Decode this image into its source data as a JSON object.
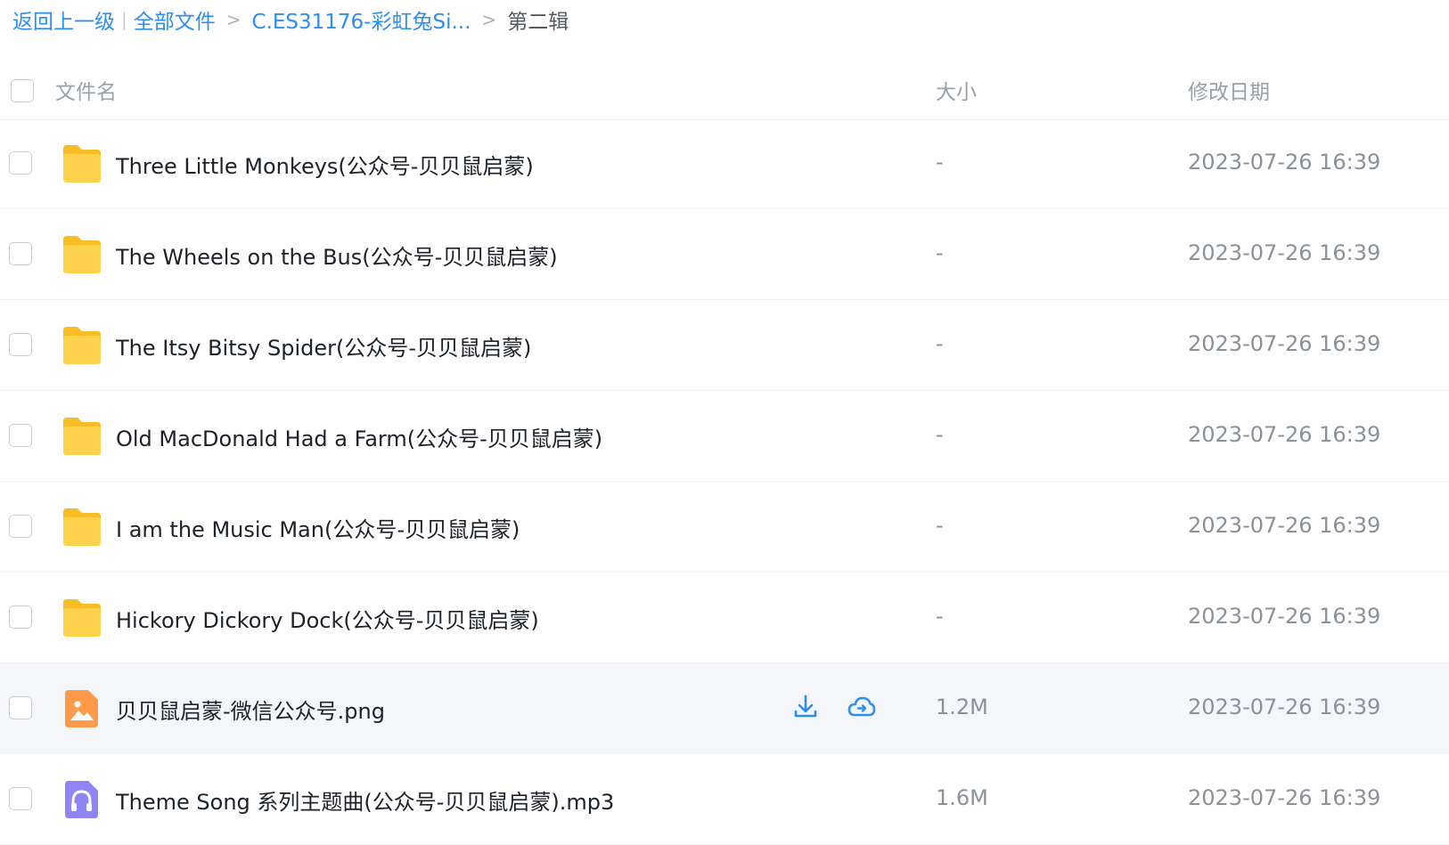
{
  "breadcrumb": {
    "back": "返回上一级",
    "separator": "|",
    "all_files": "全部文件",
    "arrow": ">",
    "parent": "C.ES31176-彩虹兔Si...",
    "current": "第二辑"
  },
  "table": {
    "headers": {
      "name": "文件名",
      "size": "大小",
      "date": "修改日期"
    },
    "rows": [
      {
        "name": "Three Little Monkeys(公众号-贝贝鼠启蒙)",
        "size": "-",
        "date": "2023-07-26 16:39",
        "icon": "folder-icon"
      },
      {
        "name": "The Wheels on the Bus(公众号-贝贝鼠启蒙)",
        "size": "-",
        "date": "2023-07-26 16:39",
        "icon": "folder-icon"
      },
      {
        "name": "The Itsy Bitsy Spider(公众号-贝贝鼠启蒙)",
        "size": "-",
        "date": "2023-07-26 16:39",
        "icon": "folder-icon"
      },
      {
        "name": "Old MacDonald Had a Farm(公众号-贝贝鼠启蒙)",
        "size": "-",
        "date": "2023-07-26 16:39",
        "icon": "folder-icon"
      },
      {
        "name": "I am the Music Man(公众号-贝贝鼠启蒙)",
        "size": "-",
        "date": "2023-07-26 16:39",
        "icon": "folder-icon"
      },
      {
        "name": "Hickory Dickory Dock(公众号-贝贝鼠启蒙)",
        "size": "-",
        "date": "2023-07-26 16:39",
        "icon": "folder-icon"
      },
      {
        "name": "贝贝鼠启蒙-微信公众号.png",
        "size": "1.2M",
        "date": "2023-07-26 16:39",
        "icon": "image-file-icon"
      },
      {
        "name": "Theme Song 系列主题曲(公众号-贝贝鼠启蒙).mp3",
        "size": "1.6M",
        "date": "2023-07-26 16:39",
        "icon": "audio-file-icon"
      }
    ]
  },
  "colors": {
    "link": "#2e8ef0",
    "folder": "#ffd24d",
    "image_icon": "#ff9a4a",
    "audio_icon": "#8f85f5",
    "hover_row": "#f5f6f9"
  },
  "row_actions": [
    "download-icon",
    "save-to-cloud-icon"
  ]
}
